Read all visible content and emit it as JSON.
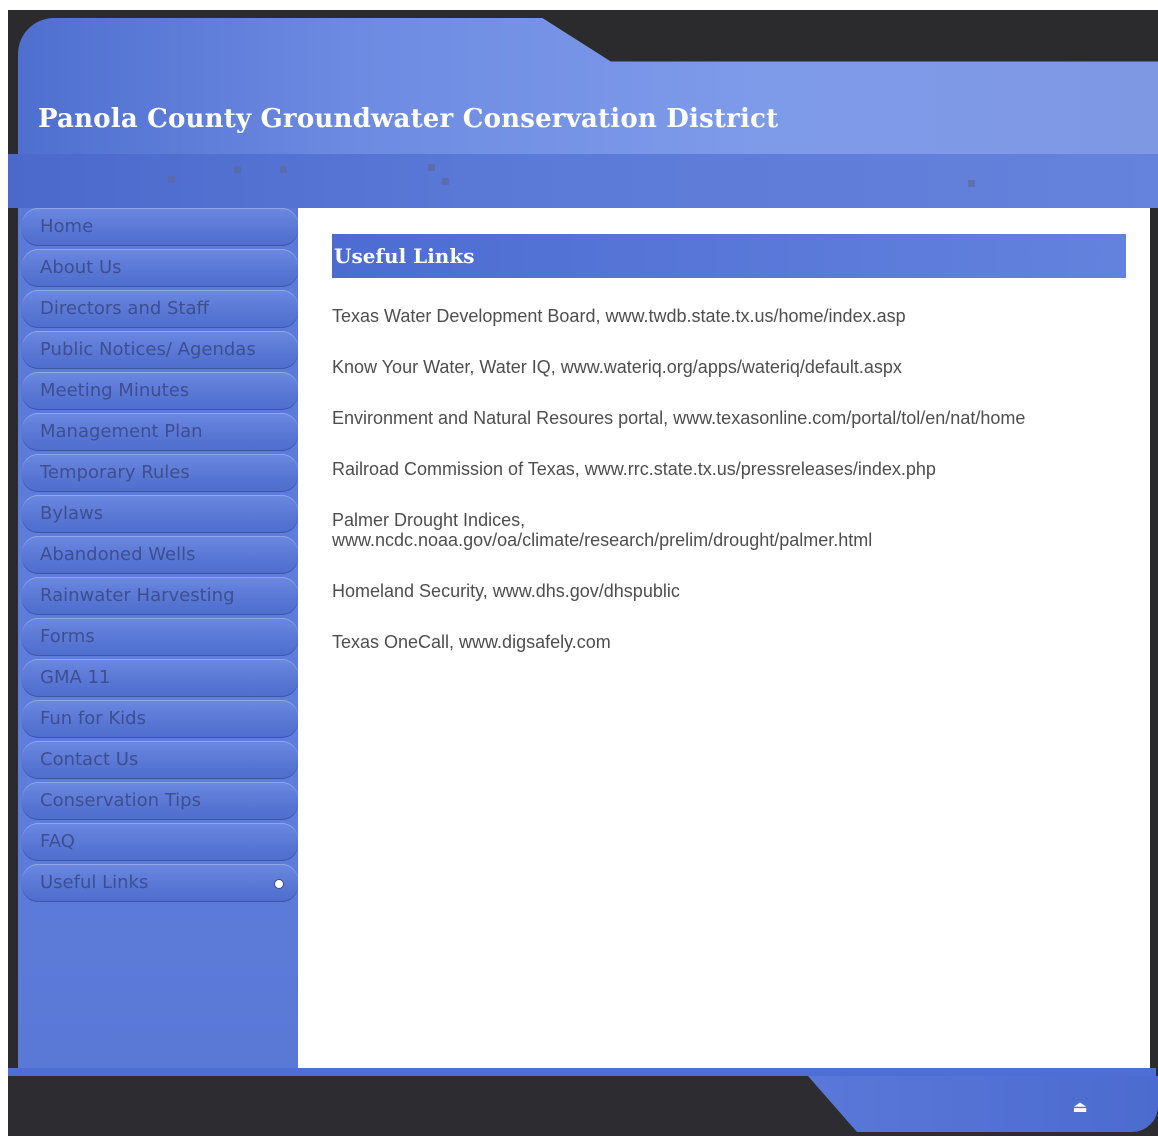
{
  "header": {
    "site_title": "Panola County Groundwater Conservation District"
  },
  "colors": {
    "header_blue": "#6d8be2",
    "sidebar_blue": "#5b79d8",
    "title_bar_blue": "#4d6cd2",
    "frame_dark": "#2b2b2e",
    "nav_text": "#3e4f90"
  },
  "sidebar": {
    "items": [
      {
        "label": "Home"
      },
      {
        "label": "About Us"
      },
      {
        "label": "Directors and Staff"
      },
      {
        "label": "Public Notices/ Agendas"
      },
      {
        "label": "Meeting Minutes"
      },
      {
        "label": "Management Plan"
      },
      {
        "label": "Temporary Rules"
      },
      {
        "label": "Bylaws"
      },
      {
        "label": "Abandoned Wells"
      },
      {
        "label": "Rainwater Harvesting"
      },
      {
        "label": "Forms"
      },
      {
        "label": "GMA 11"
      },
      {
        "label": "Fun for Kids"
      },
      {
        "label": "Contact Us"
      },
      {
        "label": "Conservation Tips"
      },
      {
        "label": "FAQ"
      },
      {
        "label": "Useful Links",
        "active": true
      }
    ]
  },
  "main": {
    "section_title": "Useful Links",
    "links": [
      {
        "text": "Texas Water Development Board, www.twdb.state.tx.us/home/index.asp"
      },
      {
        "text": "Know Your Water, Water IQ,  www.wateriq.org/apps/wateriq/default.aspx"
      },
      {
        "text": "Environment and Natural Resoures portal, www.texasonline.com/portal/tol/en/nat/home"
      },
      {
        "text": "Railroad Commission of Texas, www.rrc.state.tx.us/pressreleases/index.php"
      },
      {
        "line1": "Palmer Drought Indices,",
        "line2": "www.ncdc.noaa.gov/oa/climate/research/prelim/drought/palmer.html"
      },
      {
        "text": "Homeland Security,  www.dhs.gov/dhspublic"
      },
      {
        "text": "Texas OneCall, www.digsafely.com"
      }
    ]
  },
  "footer": {
    "back_to_top_icon": "eject-up-arrow-icon"
  }
}
